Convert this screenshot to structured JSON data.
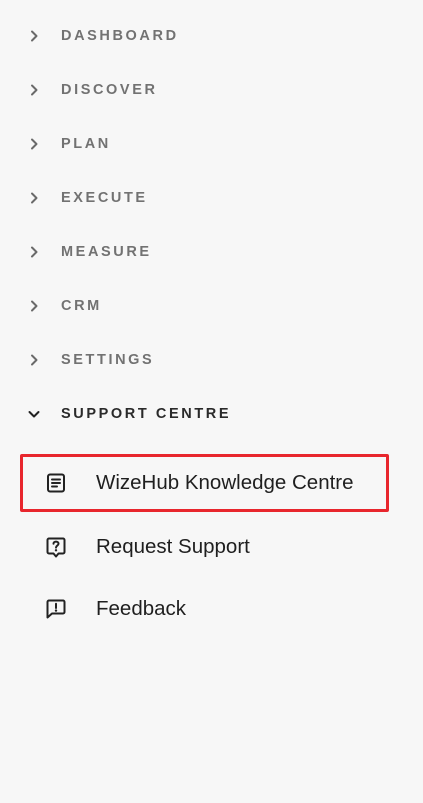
{
  "sidebar": {
    "sections": [
      {
        "label": "DASHBOARD",
        "expanded": false
      },
      {
        "label": "DISCOVER",
        "expanded": false
      },
      {
        "label": "PLAN",
        "expanded": false
      },
      {
        "label": "EXECUTE",
        "expanded": false
      },
      {
        "label": "MEASURE",
        "expanded": false
      },
      {
        "label": "CRM",
        "expanded": false
      },
      {
        "label": "SETTINGS",
        "expanded": false
      },
      {
        "label": "SUPPORT CENTRE",
        "expanded": true
      }
    ],
    "support_items": [
      {
        "label": "WizeHub Knowledge Centre",
        "icon": "article-icon",
        "highlighted": true
      },
      {
        "label": "Request Support",
        "icon": "question-icon",
        "highlighted": false
      },
      {
        "label": "Feedback",
        "icon": "feedback-icon",
        "highlighted": false
      }
    ]
  },
  "colors": {
    "background": "#f7f7f7",
    "section_label": "#727272",
    "section_label_expanded": "#2a2a2a",
    "highlight_border": "#e8262d",
    "item_text": "#1f1f1f"
  }
}
